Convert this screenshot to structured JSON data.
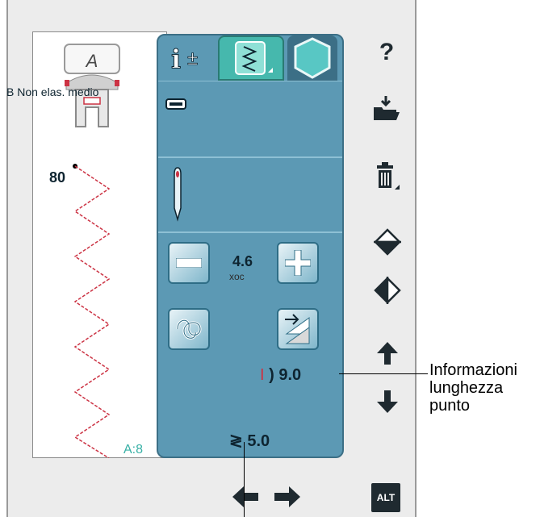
{
  "stitch_preview": {
    "code": "A:8"
  },
  "tabs": {
    "info_tab_icon": "info-icon",
    "stitch_tab_icon": "stitch-menu-icon",
    "round_tab_icon": "hexagon-icon"
  },
  "panel": {
    "stitch_name": "B Non elas. medio",
    "needle_size": "80",
    "current_value": "4.6",
    "current_value_sub": "xoc",
    "length_value": "9.0",
    "width_value": "5.0"
  },
  "sidebar": {
    "help": "?",
    "alt_label": "ALT"
  },
  "annotations": {
    "length_info": [
      "Informazioni",
      "lunghezza",
      "punto"
    ]
  },
  "colors": {
    "panel": "#5c99b4",
    "stitch_tab": "#46b8ad",
    "stitch_line": "#cc3344",
    "code": "#36b0a5"
  }
}
